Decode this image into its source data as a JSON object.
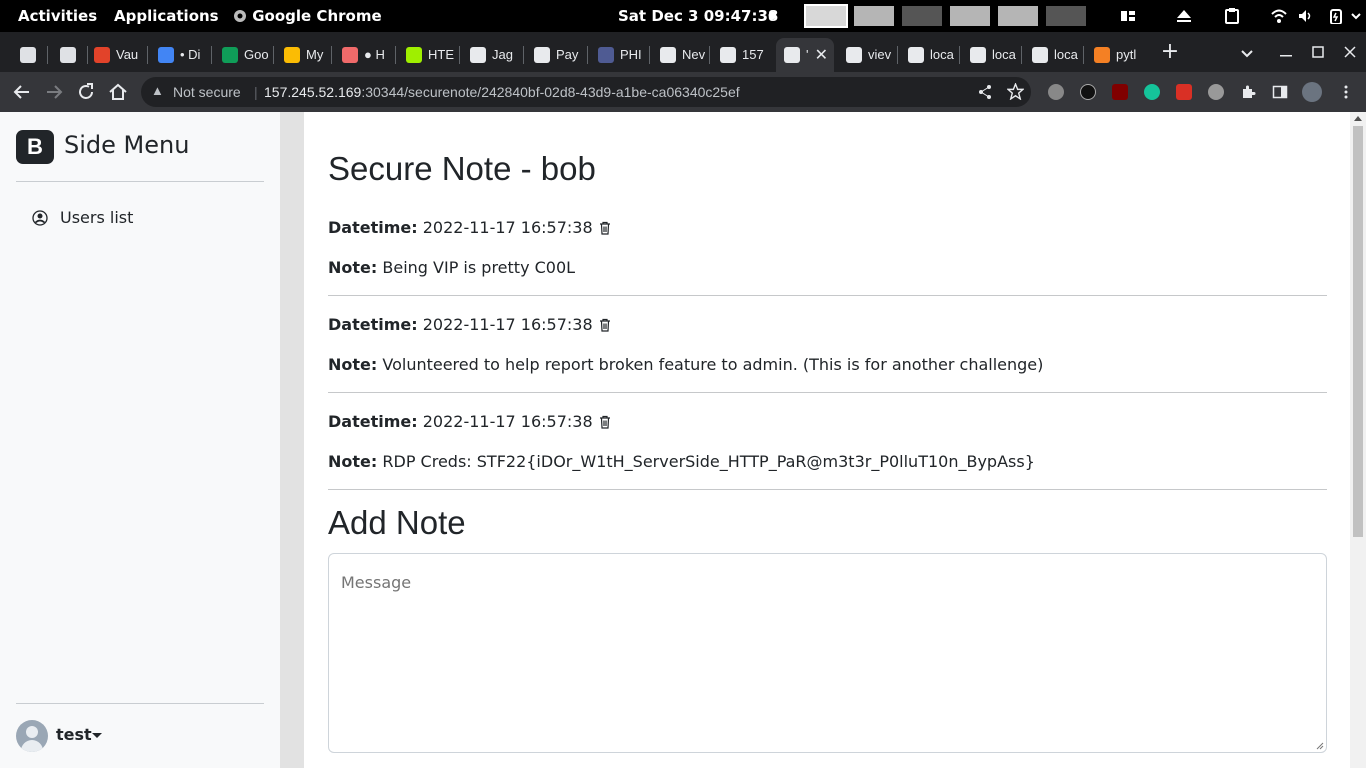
{
  "topbar": {
    "activities": "Activities",
    "applications": "Applications",
    "app_name": "Google Chrome",
    "clock": "Sat Dec 3  09:47:38"
  },
  "tabs": [
    {
      "label": "",
      "color": "#dfe1e5"
    },
    {
      "label": "",
      "color": "#dfe1e5"
    },
    {
      "label": "Vau",
      "color": "#e2432a"
    },
    {
      "label": "• Di",
      "color": "#4285f4"
    },
    {
      "label": "Goo",
      "color": "#0f9d58"
    },
    {
      "label": "My",
      "color": "#fbbc04"
    },
    {
      "label": "● H",
      "color": "#f06a6a"
    },
    {
      "label": "HTE",
      "color": "#9fef00"
    },
    {
      "label": "Jag",
      "color": "#e8eaed"
    },
    {
      "label": "Pay",
      "color": "#e8eaed"
    },
    {
      "label": "PHI",
      "color": "#4f5b93"
    },
    {
      "label": "Nev",
      "color": "#e8eaed"
    },
    {
      "label": "157",
      "color": "#e8eaed"
    },
    {
      "label": "'",
      "color": "#e8eaed"
    },
    {
      "label": "viev",
      "color": "#e8eaed"
    },
    {
      "label": "loca",
      "color": "#e8eaed"
    },
    {
      "label": "loca",
      "color": "#e8eaed"
    },
    {
      "label": "loca",
      "color": "#e8eaed"
    },
    {
      "label": "pytl",
      "color": "#f48024"
    }
  ],
  "toolbar": {
    "security_label": "Not secure",
    "url_host": "157.245.52.169",
    "url_path": ":30344/securenote/242840bf-02d8-43d9-a1be-ca06340c25ef"
  },
  "sidebar": {
    "brand_letter": "B",
    "brand_title": "Side Menu",
    "items": [
      {
        "label": "Users list"
      }
    ],
    "username": "test"
  },
  "main": {
    "title": "Secure Note - bob",
    "datetime_label": "Datetime:",
    "note_label": "Note:",
    "notes": [
      {
        "datetime": "2022-11-17 16:57:38",
        "note": "Being VIP is pretty C00L"
      },
      {
        "datetime": "2022-11-17 16:57:38",
        "note": "Volunteered to help report broken feature to admin. (This is for another challenge)"
      },
      {
        "datetime": "2022-11-17 16:57:38",
        "note": "RDP Creds: STF22{iDOr_W1tH_ServerSide_HTTP_PaR@m3t3r_P0lluT10n_BypAss}"
      }
    ],
    "add_title": "Add Note",
    "message_placeholder": "Message"
  }
}
